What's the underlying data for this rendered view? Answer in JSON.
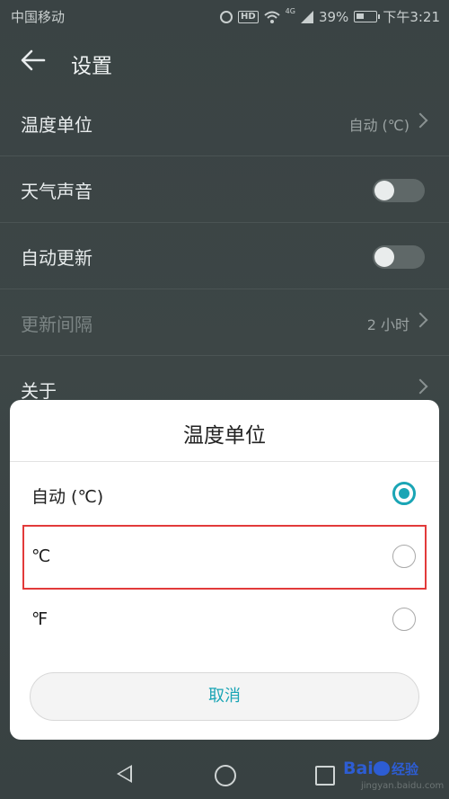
{
  "status_bar": {
    "carrier": "中国移动",
    "network": "4G",
    "battery": "39%",
    "time": "下午3:21"
  },
  "header": {
    "title": "设置"
  },
  "settings": [
    {
      "label": "温度单位",
      "value": "自动 (℃)",
      "type": "link"
    },
    {
      "label": "天气声音",
      "type": "toggle",
      "on": false
    },
    {
      "label": "自动更新",
      "type": "toggle",
      "on": false
    },
    {
      "label": "更新间隔",
      "value": "2 小时",
      "type": "link",
      "disabled": true
    },
    {
      "label": "关于",
      "type": "link"
    }
  ],
  "dialog": {
    "title": "温度单位",
    "options": [
      {
        "label": "自动 (℃)",
        "selected": true
      },
      {
        "label": "℃",
        "selected": false
      },
      {
        "label": "℉",
        "selected": false
      }
    ],
    "cancel": "取消"
  },
  "watermark": {
    "logo": "Bai",
    "text": "经验",
    "url": "jingyan.baidu.com"
  },
  "colors": {
    "accent": "#1aa5b5",
    "highlight": "#e23a3a"
  }
}
